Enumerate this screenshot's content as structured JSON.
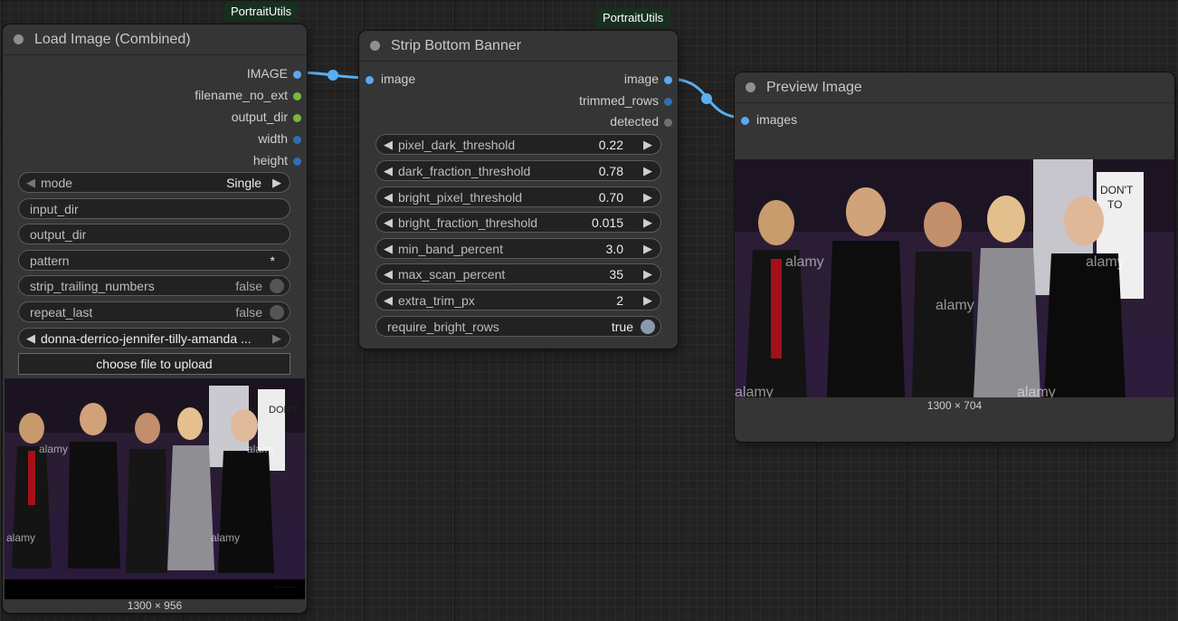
{
  "badges": {
    "load": "PortraitUtils",
    "strip": "PortraitUtils"
  },
  "load_node": {
    "title": "Load Image (Combined)",
    "outputs": [
      "IMAGE",
      "filename_no_ext",
      "output_dir",
      "width",
      "height"
    ],
    "mode_label": "mode",
    "mode_value": "Single",
    "input_dir_label": "input_dir",
    "output_dir_label": "output_dir",
    "pattern_label": "pattern",
    "pattern_value": "*",
    "strip_label": "strip_trailing_numbers",
    "strip_value": "false",
    "repeat_label": "repeat_last",
    "repeat_value": "false",
    "file_value": "donna-derrico-jennifer-tilly-amanda ...",
    "upload_label": "choose file to upload",
    "dims": "1300 × 956",
    "photo_logo": "alamy"
  },
  "strip_node": {
    "title": "Strip Bottom Banner",
    "input": "image",
    "outputs": [
      "image",
      "trimmed_rows",
      "detected"
    ],
    "params": [
      {
        "label": "pixel_dark_threshold",
        "value": "0.22"
      },
      {
        "label": "dark_fraction_threshold",
        "value": "0.78"
      },
      {
        "label": "bright_pixel_threshold",
        "value": "0.70"
      },
      {
        "label": "bright_fraction_threshold",
        "value": "0.015"
      },
      {
        "label": "min_band_percent",
        "value": "3.0"
      },
      {
        "label": "max_scan_percent",
        "value": "35"
      },
      {
        "label": "extra_trim_px",
        "value": "2"
      }
    ],
    "require_label": "require_bright_rows",
    "require_value": "true"
  },
  "preview_node": {
    "title": "Preview Image",
    "input": "images",
    "dims": "1300 × 704"
  },
  "colors": {
    "image_slot": "#5aa8f0",
    "string_slot": "#7bb83a",
    "int_slot": "#2f6fb0",
    "bool_slot": "#6e6e78",
    "link": "#5aaff0"
  }
}
